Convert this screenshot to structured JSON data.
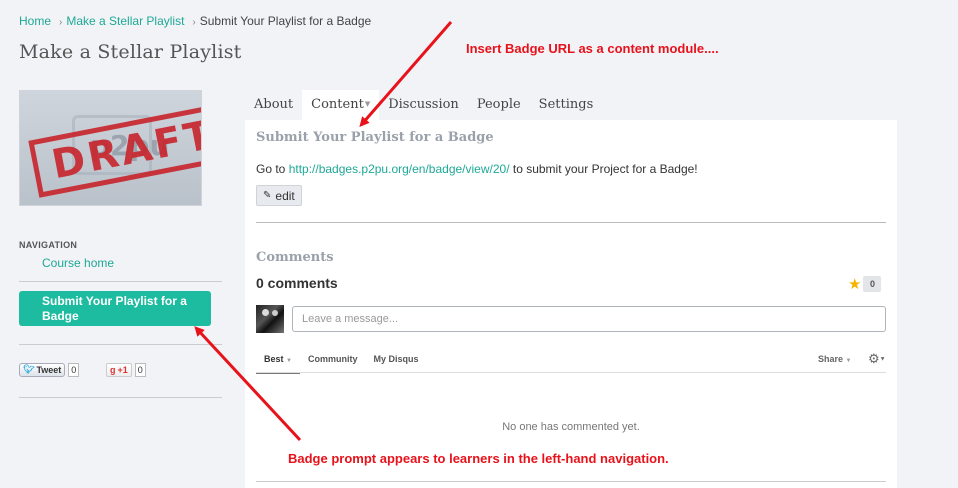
{
  "breadcrumb": {
    "home": "Home",
    "course": "Make a Stellar Playlist",
    "current": "Submit Your Playlist for a Badge",
    "separator": "›"
  },
  "page_title": "Make a Stellar Playlist",
  "thumbnail": {
    "stamp_text": "DRAFT",
    "ghost_text": "p2pu"
  },
  "sidebar": {
    "nav_label": "NAVIGATION",
    "items": [
      {
        "label": "Course home"
      },
      {
        "label": "Submit Your Playlist for a Badge"
      }
    ],
    "social": {
      "tweet_label": "Tweet",
      "tweet_count": "0",
      "gplus_label": "+1",
      "gplus_count": "0"
    }
  },
  "tabs": [
    {
      "label": "About"
    },
    {
      "label": "Content"
    },
    {
      "label": "Discussion"
    },
    {
      "label": "People"
    },
    {
      "label": "Settings"
    }
  ],
  "content": {
    "title": "Submit Your Playlist for a Badge",
    "text_before": "Go to ",
    "link": "http://badges.p2pu.org/en/badge/view/20/",
    "text_after": " to submit your Project for a Badge!",
    "edit_label": "edit"
  },
  "comments": {
    "section_title": "Comments",
    "count_label": "0 comments",
    "star_count": "0",
    "input_placeholder": "Leave a message...",
    "sort_tabs": [
      {
        "label": "Best"
      },
      {
        "label": "Community"
      },
      {
        "label": "My Disqus"
      }
    ],
    "share_label": "Share",
    "empty_message": "No one has commented yet."
  },
  "annotations": {
    "top": "Insert Badge URL as a content module....",
    "bottom": "Badge prompt appears to learners in the left-hand navigation."
  },
  "colors": {
    "accent": "#1ea896",
    "button": "#1dbb9f",
    "annotation": "#e8121b"
  }
}
